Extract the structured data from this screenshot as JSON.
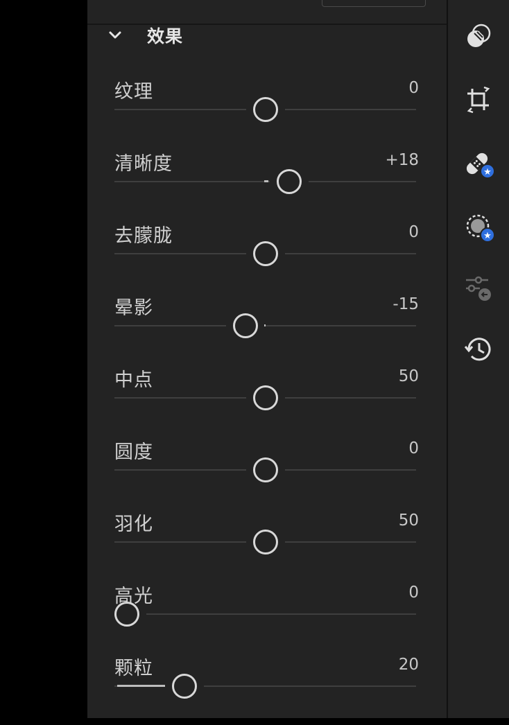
{
  "section": {
    "title": "效果",
    "chevron_icon": "chevron-down-icon"
  },
  "sliders": [
    {
      "id": "texture",
      "label": "纹理",
      "value_text": "0",
      "value": 0,
      "min": -100,
      "max": 100
    },
    {
      "id": "clarity",
      "label": "清晰度",
      "value_text": "+18",
      "value": 18,
      "min": -100,
      "max": 100
    },
    {
      "id": "dehaze",
      "label": "去朦胧",
      "value_text": "0",
      "value": 0,
      "min": -100,
      "max": 100
    },
    {
      "id": "vignette",
      "label": "晕影",
      "value_text": "-15",
      "value": -15,
      "min": -100,
      "max": 100
    },
    {
      "id": "midpoint",
      "label": "中点",
      "value_text": "50",
      "value": 50,
      "min": 0,
      "max": 100
    },
    {
      "id": "roundness",
      "label": "圆度",
      "value_text": "0",
      "value": 0,
      "min": -100,
      "max": 100
    },
    {
      "id": "feather",
      "label": "羽化",
      "value_text": "50",
      "value": 50,
      "min": 0,
      "max": 100
    },
    {
      "id": "highlights",
      "label": "高光",
      "value_text": "0",
      "value": 0,
      "min": 0,
      "max": 100
    },
    {
      "id": "grain",
      "label": "颗粒",
      "value_text": "20",
      "value": 20,
      "min": 0,
      "max": 100
    }
  ],
  "toolbar": {
    "tools": [
      {
        "id": "edit",
        "icon": "edit-circles-icon"
      },
      {
        "id": "crop",
        "icon": "crop-rotate-icon"
      },
      {
        "id": "healing",
        "icon": "healing-bandage-icon",
        "badge": "star"
      },
      {
        "id": "masking",
        "icon": "masking-icon",
        "badge": "star"
      },
      {
        "id": "presets",
        "icon": "presets-sliders-icon"
      },
      {
        "id": "history",
        "icon": "history-clock-icon"
      }
    ]
  },
  "colors": {
    "panel_bg": "#232323",
    "text": "#d0d0d0",
    "track": "#3f3f3f",
    "knob": "#d8d8d8",
    "badge": "#2f6fde"
  }
}
